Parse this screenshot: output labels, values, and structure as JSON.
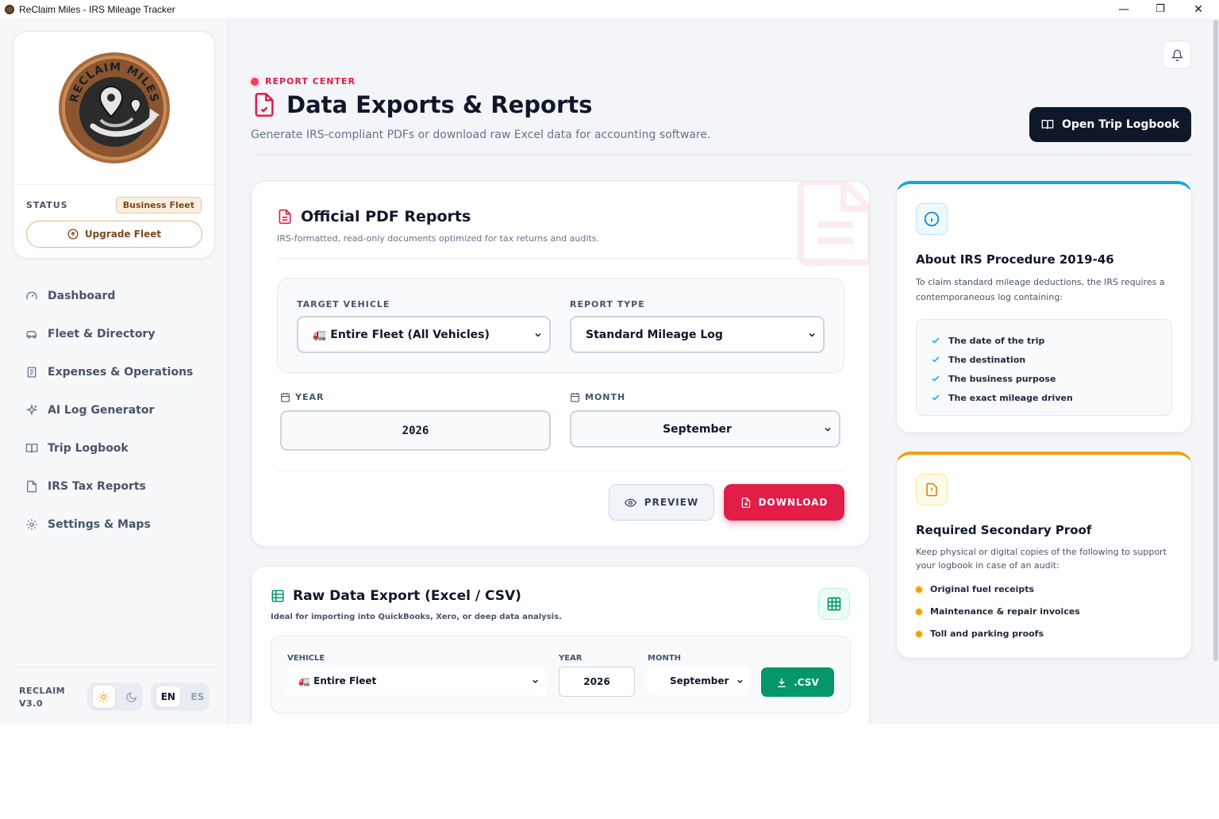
{
  "window": {
    "title": "ReClaim Miles - IRS Mileage Tracker",
    "minimize": "—",
    "restore": "❐",
    "close": "✕"
  },
  "sidebar": {
    "logo_text": "RECLAIM MILES",
    "status_label": "STATUS",
    "status_badge": "Business Fleet",
    "upgrade_label": "Upgrade Fleet",
    "nav": [
      {
        "label": "Dashboard",
        "icon": "gauge-icon"
      },
      {
        "label": "Fleet & Directory",
        "icon": "car-icon"
      },
      {
        "label": "Expenses & Operations",
        "icon": "receipt-icon"
      },
      {
        "label": "AI Log Generator",
        "icon": "sparkles-icon"
      },
      {
        "label": "Trip Logbook",
        "icon": "book-icon"
      },
      {
        "label": "IRS Tax Reports",
        "icon": "file-icon"
      },
      {
        "label": "Settings & Maps",
        "icon": "gear-icon"
      }
    ],
    "version_line1": "RECLAIM",
    "version_line2": "V3.0",
    "lang_en": "EN",
    "lang_es": "ES"
  },
  "header": {
    "kicker": "REPORT CENTER",
    "title": "Data Exports & Reports",
    "subtitle": "Generate IRS-compliant PDFs or download raw Excel data for accounting software.",
    "open_logbook": "Open Trip Logbook"
  },
  "pdf_reports": {
    "title": "Official PDF Reports",
    "subtitle": "IRS-formatted, read-only documents optimized for tax returns and audits.",
    "target_vehicle_label": "TARGET VEHICLE",
    "target_vehicle_value": "🚛 Entire Fleet (All Vehicles)",
    "report_type_label": "REPORT TYPE",
    "report_type_value": "Standard Mileage Log",
    "year_label": "YEAR",
    "year_value": "2026",
    "month_label": "MONTH",
    "month_value": "September",
    "preview_label": "PREVIEW",
    "download_label": "DOWNLOAD"
  },
  "raw_export": {
    "title": "Raw Data Export (Excel / CSV)",
    "subtitle": "Ideal for importing into QuickBooks, Xero, or deep data analysis.",
    "vehicle_label": "VEHICLE",
    "vehicle_value": "🚛 Entire Fleet",
    "year_label": "YEAR",
    "year_value": "2026",
    "month_label": "MONTH",
    "month_value": "September",
    "csv_label": ".CSV"
  },
  "irs_info": {
    "title": "About IRS Procedure 2019-46",
    "body": "To claim standard mileage deductions, the IRS requires a contemporaneous log containing:",
    "items": [
      "The date of the trip",
      "The destination",
      "The business purpose",
      "The exact mileage driven"
    ]
  },
  "proof": {
    "title": "Required Secondary Proof",
    "body": "Keep physical or digital copies of the following to support your logbook in case of an audit:",
    "items": [
      "Original fuel receipts",
      "Maintenance & repair invoices",
      "Toll and parking proofs"
    ]
  },
  "colors": {
    "accent_red": "#e11d48",
    "dark": "#0f172a",
    "green": "#059669",
    "sky": "#0ea5e9",
    "amber": "#f59e0b",
    "bronze": "#7c4a1e"
  }
}
